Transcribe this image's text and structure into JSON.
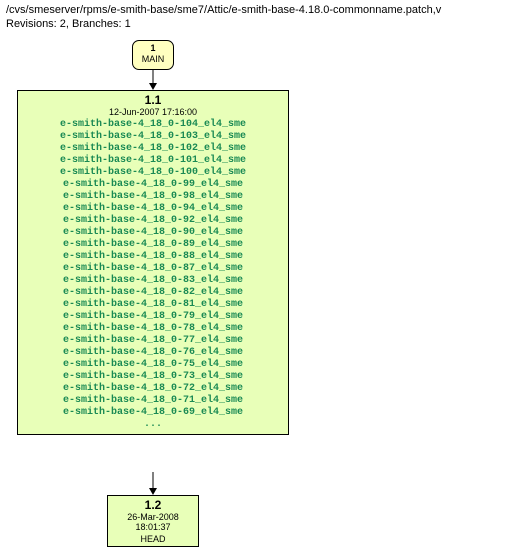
{
  "header": {
    "path": "/cvs/smeserver/rpms/e-smith-base/sme7/Attic/e-smith-base-4.18.0-commonname.patch,v",
    "meta": "Revisions: 2, Branches: 1"
  },
  "main": {
    "num": "1",
    "label": "MAIN"
  },
  "rev11": {
    "ver": "1.1",
    "date": "12-Jun-2007 17:16:00",
    "tags": [
      "e-smith-base-4_18_0-104_el4_sme",
      "e-smith-base-4_18_0-103_el4_sme",
      "e-smith-base-4_18_0-102_el4_sme",
      "e-smith-base-4_18_0-101_el4_sme",
      "e-smith-base-4_18_0-100_el4_sme",
      "e-smith-base-4_18_0-99_el4_sme",
      "e-smith-base-4_18_0-98_el4_sme",
      "e-smith-base-4_18_0-94_el4_sme",
      "e-smith-base-4_18_0-92_el4_sme",
      "e-smith-base-4_18_0-90_el4_sme",
      "e-smith-base-4_18_0-89_el4_sme",
      "e-smith-base-4_18_0-88_el4_sme",
      "e-smith-base-4_18_0-87_el4_sme",
      "e-smith-base-4_18_0-83_el4_sme",
      "e-smith-base-4_18_0-82_el4_sme",
      "e-smith-base-4_18_0-81_el4_sme",
      "e-smith-base-4_18_0-79_el4_sme",
      "e-smith-base-4_18_0-78_el4_sme",
      "e-smith-base-4_18_0-77_el4_sme",
      "e-smith-base-4_18_0-76_el4_sme",
      "e-smith-base-4_18_0-75_el4_sme",
      "e-smith-base-4_18_0-73_el4_sme",
      "e-smith-base-4_18_0-72_el4_sme",
      "e-smith-base-4_18_0-71_el4_sme",
      "e-smith-base-4_18_0-69_el4_sme"
    ],
    "more": "..."
  },
  "rev12": {
    "ver": "1.2",
    "date": "26-Mar-2008 18:01:37",
    "head": "HEAD"
  }
}
